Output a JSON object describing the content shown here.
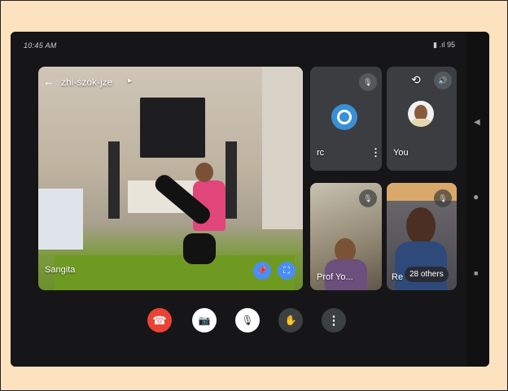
{
  "status": {
    "time": "10:45 AM",
    "right": "▮ .ıl 95"
  },
  "meeting": {
    "code": "zhi-szok-jze"
  },
  "participants": {
    "main": {
      "name": "Sangita"
    },
    "tile_rc": {
      "name": "rc"
    },
    "tile_you": {
      "name": "You"
    },
    "tile_prof": {
      "name": "Prof Yo..."
    },
    "tile_re": {
      "name": "Re"
    },
    "others_badge": "28 others"
  },
  "colors": {
    "end_call": "#ea4335",
    "control_white": "#ffffff",
    "control_dark": "#3c4043",
    "pin_blue": "#4a8df6",
    "page_bg": "#fde2c0"
  },
  "icons": {
    "back": "←",
    "chevron": "▸",
    "mic_off": "🎙",
    "switch_camera": "⟲",
    "speaker": "🔊",
    "more": "⋮",
    "pin": "📌",
    "fullscreen": "⛶",
    "end_call": "☎",
    "camera_off": "📷",
    "raise_hand": "✋",
    "nav_back": "◀",
    "nav_home": "●",
    "nav_recent": "■"
  }
}
